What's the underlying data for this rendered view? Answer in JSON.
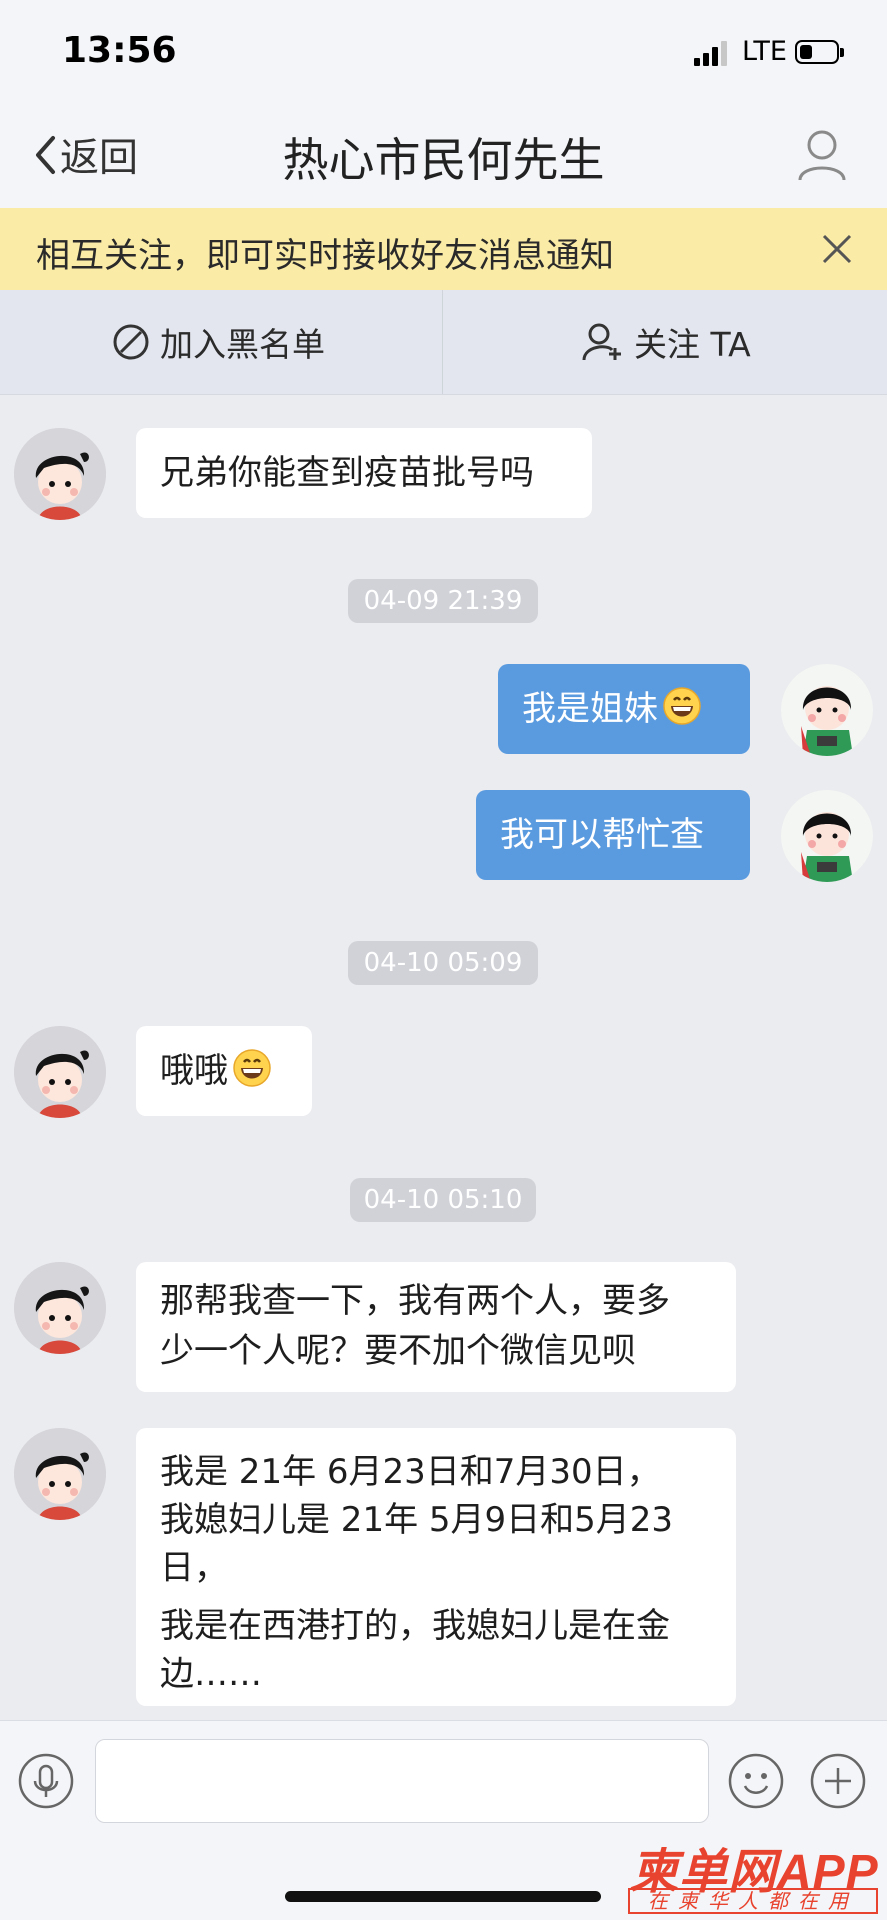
{
  "status_bar": {
    "time": "13:56",
    "network": "LTE",
    "battery_level": 0.35
  },
  "nav": {
    "back_label": "返回",
    "title": "热心市民何先生"
  },
  "notice": {
    "text": "相互关注，即可实时接收好友消息通知"
  },
  "actions": {
    "blacklist_label": "加入黑名单",
    "follow_label": "关注 TA"
  },
  "messages": [
    {
      "side": "left",
      "text": "兄弟你能查到疫苗批号吗"
    },
    {
      "type": "timestamp",
      "text": "04-09 21:39"
    },
    {
      "side": "right",
      "text": "我是姐妹",
      "emoji": "grinning-face"
    },
    {
      "side": "right",
      "text": "我可以帮忙查"
    },
    {
      "type": "timestamp",
      "text": "04-10 05:09"
    },
    {
      "side": "left",
      "text": "哦哦",
      "emoji": "grinning-face"
    },
    {
      "type": "timestamp",
      "text": "04-10 05:10"
    },
    {
      "side": "left",
      "lines": [
        "那帮我查一下，我有两个人，要多",
        "少一个人呢？要不加个微信见呗"
      ]
    },
    {
      "side": "left",
      "lines": [
        "我是 21年 6月23日和7月30日，",
        "我媳妇儿是 21年 5月9日和5月23",
        "日，",
        "我是在西港打的，我媳妇儿是在金",
        "边……"
      ]
    }
  ],
  "input_bar": {
    "placeholder": ""
  },
  "watermark": {
    "brand": "柬单网APP",
    "slogan": "在柬华人都在用"
  },
  "icons": [
    "back-chevron-icon",
    "profile-icon",
    "close-icon",
    "block-icon",
    "add-user-icon",
    "voice-icon",
    "emoji-icon",
    "plus-icon",
    "signal-icon",
    "battery-icon"
  ]
}
